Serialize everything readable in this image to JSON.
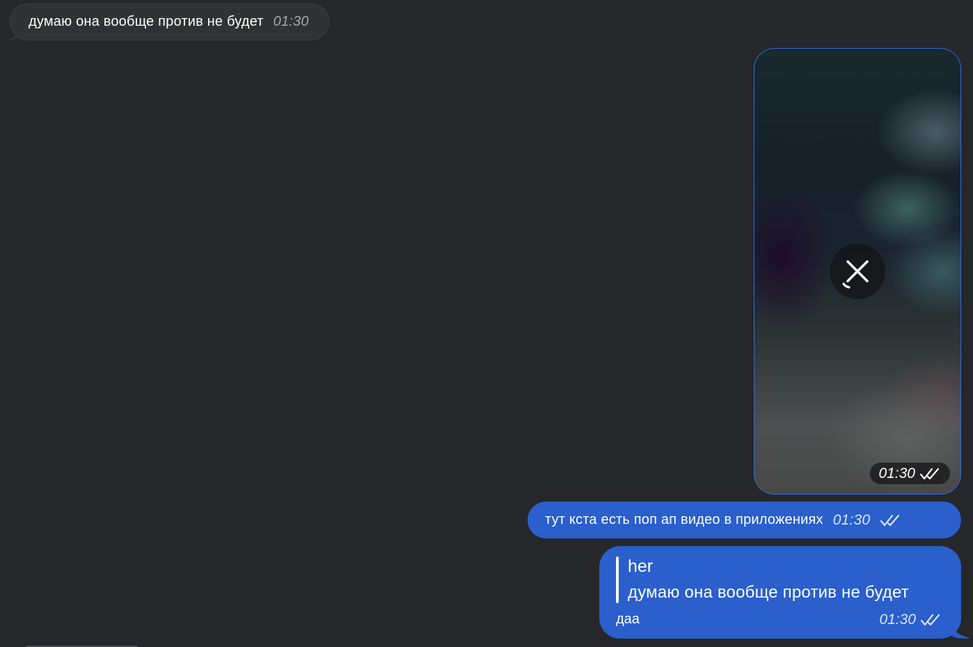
{
  "colors": {
    "background": "#25272a",
    "incoming_bubble": "#303234",
    "outgoing_bubble": "#2a5fcc",
    "video_border": "#2f6bd9"
  },
  "messages": {
    "incoming": {
      "text": "думаю она вообще против не будет",
      "time": "01:30"
    },
    "video": {
      "time": "01:30",
      "status_icon": "double-check-icon",
      "overlay_icon": "cancel-upload-icon"
    },
    "outgoing_text": {
      "text": "тут кста есть поп ап видео в приложениях",
      "time": "01:30",
      "status_icon": "double-check-icon"
    },
    "outgoing_reply": {
      "quoted_author": "her",
      "quoted_text": "думаю она вообще против не будет",
      "text": "даа",
      "time": "01:30",
      "status_icon": "double-check-icon"
    }
  }
}
